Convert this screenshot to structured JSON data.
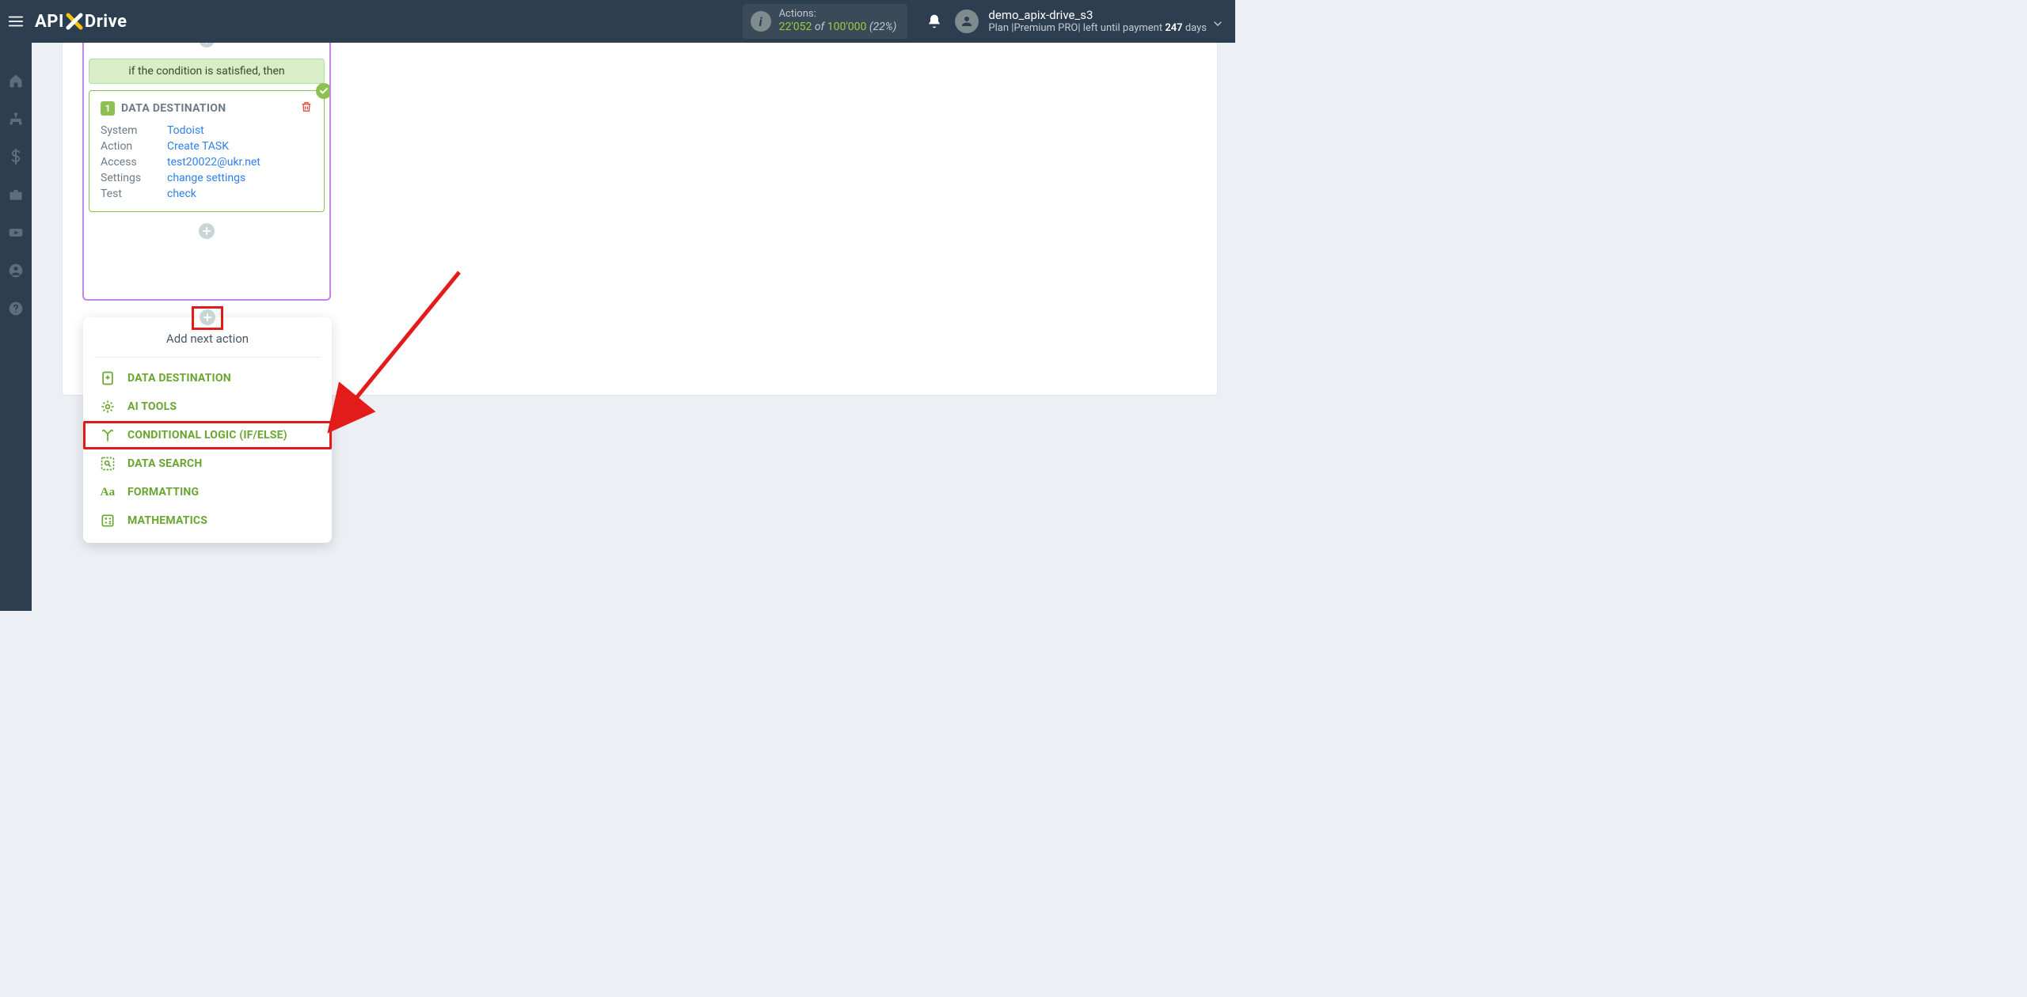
{
  "header": {
    "actions_label": "Actions:",
    "actions_used": "22'052",
    "actions_of": " of ",
    "actions_max": "100'000",
    "actions_pct": " (22%)",
    "user_name": "demo_apix-drive_s3",
    "plan_prefix": "Plan |",
    "plan_name": "Premium PRO",
    "plan_middle": "| left until payment ",
    "plan_days_num": "247",
    "plan_days_suffix": " days"
  },
  "logo": {
    "api": "API",
    "drive": "Drive"
  },
  "partial": {
    "label": "Test",
    "link": "check"
  },
  "condition_bar": "if the condition is satisfied, then",
  "dest": {
    "badge_num": "1",
    "title": "DATA DESTINATION",
    "rows": {
      "system_k": "System",
      "system_v": "Todoist",
      "action_k": "Action",
      "action_v": "Create TASK",
      "access_k": "Access",
      "access_v": "test20022@ukr.net",
      "settings_k": "Settings",
      "settings_v": "change settings",
      "test_k": "Test",
      "test_v": "check"
    }
  },
  "popup": {
    "title": "Add next action",
    "items": {
      "dest": "DATA DESTINATION",
      "ai": "AI TOOLS",
      "cond": "CONDITIONAL LOGIC (IF/ELSE)",
      "search": "DATA SEARCH",
      "format": "FORMATTING",
      "math": "MATHEMATICS"
    }
  }
}
